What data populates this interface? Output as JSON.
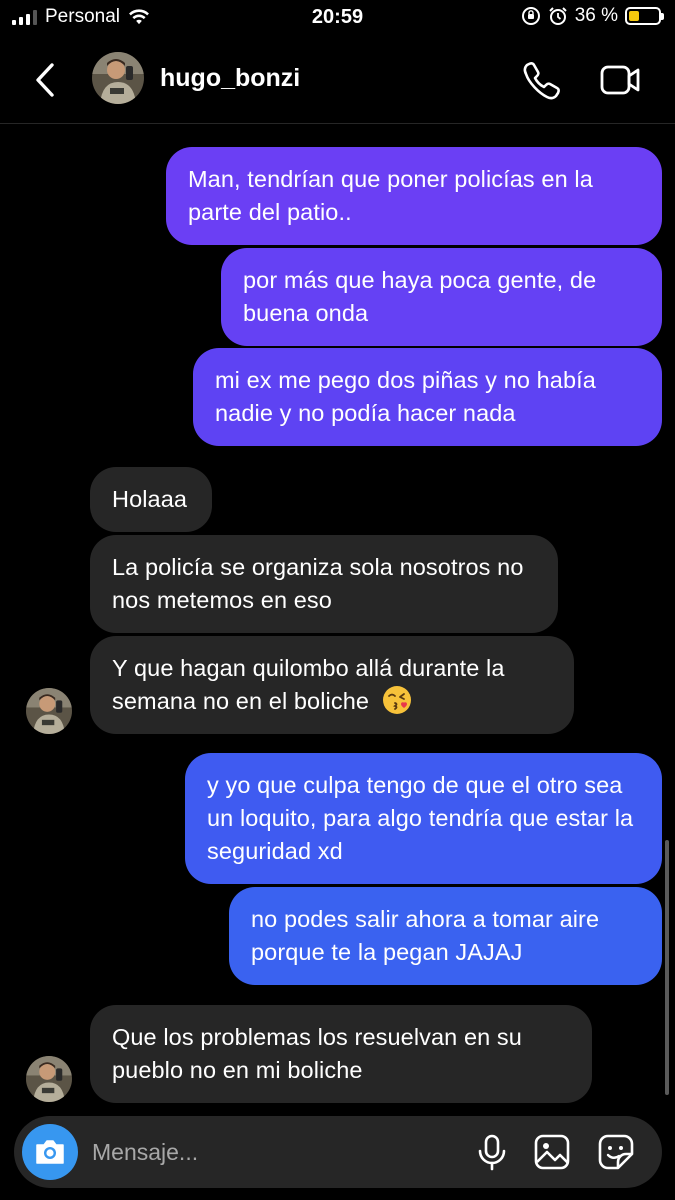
{
  "status_bar": {
    "carrier": "Personal",
    "time": "20:59",
    "battery_percent": "36 %",
    "battery_level": 0.36,
    "icons": [
      "signal-icon",
      "wifi-icon",
      "screen-lock-rotation-icon",
      "alarm-icon",
      "battery-icon"
    ]
  },
  "header": {
    "username": "hugo_bonzi",
    "icons": [
      "back-icon",
      "phone-icon",
      "video-camera-icon"
    ]
  },
  "messages": [
    {
      "direction": "sent",
      "text": "Man, tendrían que poner policías en la parte del patio..",
      "color": "#6b3ff4"
    },
    {
      "direction": "sent",
      "text": "por más que haya poca gente, de buena onda",
      "color": "#6541f4"
    },
    {
      "direction": "sent",
      "text": "mi ex me pego dos piñas y no había nadie y no podía hacer nada",
      "color": "#5e43f3"
    },
    {
      "direction": "received",
      "text": "Holaaa"
    },
    {
      "direction": "received",
      "text": "La policía se organiza sola nosotros no nos metemos en eso"
    },
    {
      "direction": "received",
      "text": "Y que hagan quilombo allá durante la semana no en el boliche",
      "emoji": "kissing-face-icon"
    },
    {
      "direction": "sent",
      "text": "y yo que culpa tengo de que el otro sea un loquito, para algo tendría que estar la seguridad xd",
      "color": "#3f5bf1"
    },
    {
      "direction": "sent",
      "text": "no podes salir ahora a tomar aire porque te la pegan JAJAJ",
      "color": "#3a62f0"
    },
    {
      "direction": "received",
      "text": "Que los problemas los resuelvan en su pueblo no en mi boliche"
    }
  ],
  "composer": {
    "placeholder": "Mensaje...",
    "value": "",
    "camera_color": "#3797f0",
    "icons": [
      "camera-icon",
      "microphone-icon",
      "gallery-icon",
      "sticker-icon"
    ]
  }
}
